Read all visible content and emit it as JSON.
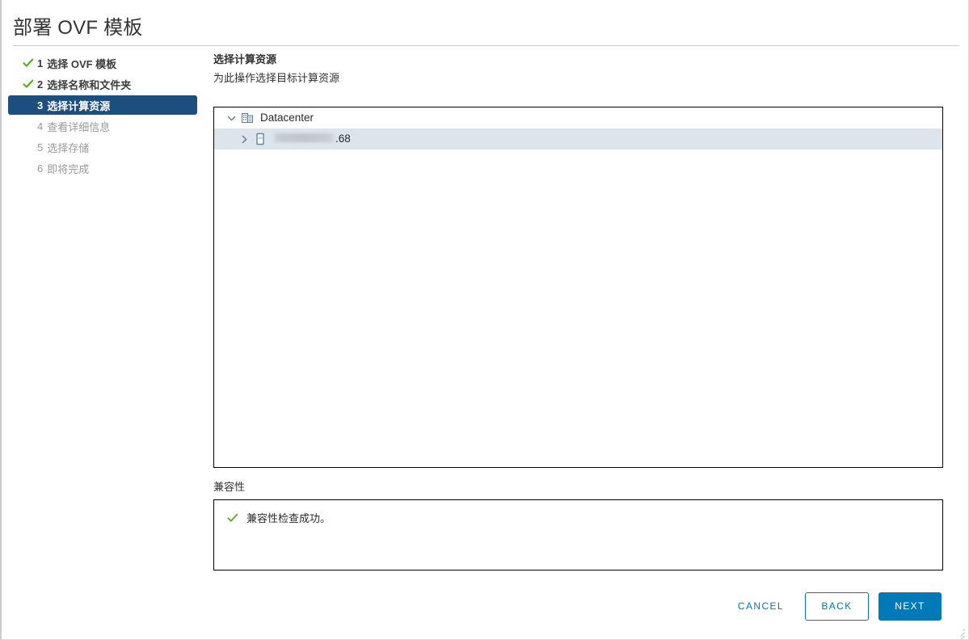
{
  "window": {
    "title": "部署 OVF 模板"
  },
  "steps": [
    {
      "num": "1",
      "label": "选择 OVF 模板",
      "state": "done",
      "icon": "check-icon"
    },
    {
      "num": "2",
      "label": "选择名称和文件夹",
      "state": "done",
      "icon": "check-icon"
    },
    {
      "num": "3",
      "label": "选择计算资源",
      "state": "current",
      "icon": ""
    },
    {
      "num": "4",
      "label": "查看详细信息",
      "state": "pending",
      "icon": ""
    },
    {
      "num": "5",
      "label": "选择存储",
      "state": "pending",
      "icon": ""
    },
    {
      "num": "6",
      "label": "即将完成",
      "state": "pending",
      "icon": ""
    }
  ],
  "main": {
    "heading": "选择计算资源",
    "subheading": "为此操作选择目标计算资源"
  },
  "tree": {
    "nodes": [
      {
        "label": "Datacenter",
        "level": 0,
        "icon": "datacenter-icon",
        "twisty": "chevron-down-icon",
        "expanded": true,
        "selected": false,
        "redacted": false
      },
      {
        "label": ".68",
        "level": 1,
        "icon": "host-icon",
        "twisty": "chevron-right-icon",
        "expanded": false,
        "selected": true,
        "redacted": true
      }
    ]
  },
  "compatibility": {
    "label": "兼容性",
    "status_icon": "check-icon",
    "status_text": "兼容性检查成功。"
  },
  "footer": {
    "cancel_label": "CANCEL",
    "back_label": "BACK",
    "next_label": "NEXT"
  },
  "colors": {
    "accent": "#0079b8",
    "step_selected_bg": "#1c4e7e",
    "row_selected_bg": "#dce4ec",
    "success_green": "#5ba822"
  }
}
